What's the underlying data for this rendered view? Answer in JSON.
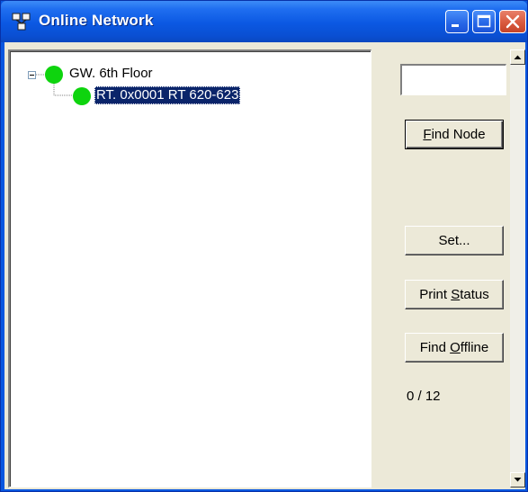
{
  "window": {
    "title": "Online Network",
    "icon": "network-app-icon",
    "controls": [
      "minimize-icon",
      "maximize-icon",
      "close-icon"
    ]
  },
  "tree": {
    "nodes": [
      {
        "label": "GW. 6th Floor",
        "status_color": "#0ed40e",
        "expanded": true,
        "level": 0
      },
      {
        "label": "RT. 0x0001 RT 620-623",
        "status_color": "#0ed40e",
        "selected": true,
        "level": 1
      }
    ]
  },
  "panel": {
    "search_value": "",
    "find_node": {
      "pre": "",
      "key": "F",
      "post": "ind Node"
    },
    "set": {
      "label": "Set..."
    },
    "print_status": {
      "pre": "Print ",
      "key": "S",
      "post": "tatus"
    },
    "find_offline": {
      "pre": "Find ",
      "key": "O",
      "post": "ffline"
    },
    "count": "0 / 12"
  },
  "colors": {
    "titlebar": "#0a57e0",
    "node_online": "#0ed40e",
    "selection": "#0a246a",
    "face": "#ece9d8"
  }
}
